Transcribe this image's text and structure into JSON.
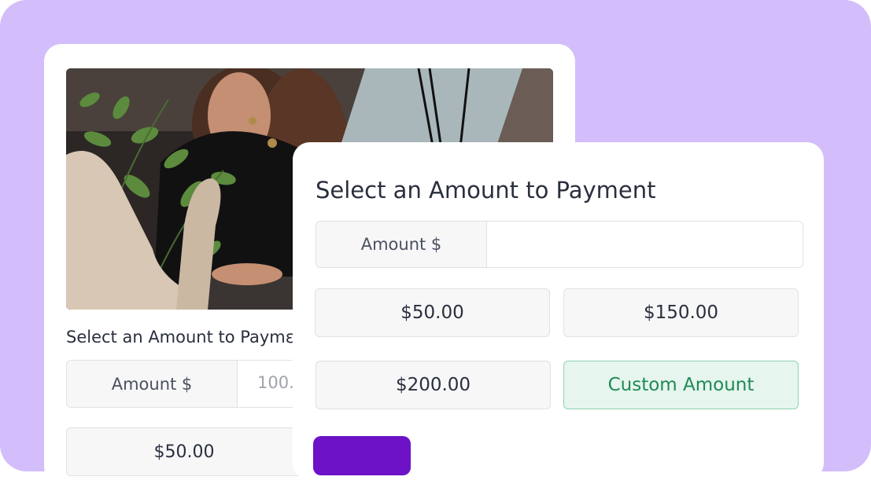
{
  "colors": {
    "background": "#d3bdfa",
    "card": "#ffffff",
    "accent": "#6d12c7",
    "selected_bg": "#e6f5ee",
    "selected_text": "#1f8a55"
  },
  "back_form": {
    "title": "Select an Amount to Paymε",
    "amount_addon": "Amount  $",
    "amount_value": "100.",
    "option_partial": "$50.00"
  },
  "front_form": {
    "title": "Select an Amount to Payment",
    "amount_addon": "Amount  $",
    "amount_value": "",
    "options": [
      {
        "label": "$50.00",
        "selected": false
      },
      {
        "label": "$150.00",
        "selected": false
      },
      {
        "label": "$200.00",
        "selected": false
      },
      {
        "label": "Custom Amount",
        "selected": true
      }
    ],
    "submit_label": ""
  }
}
